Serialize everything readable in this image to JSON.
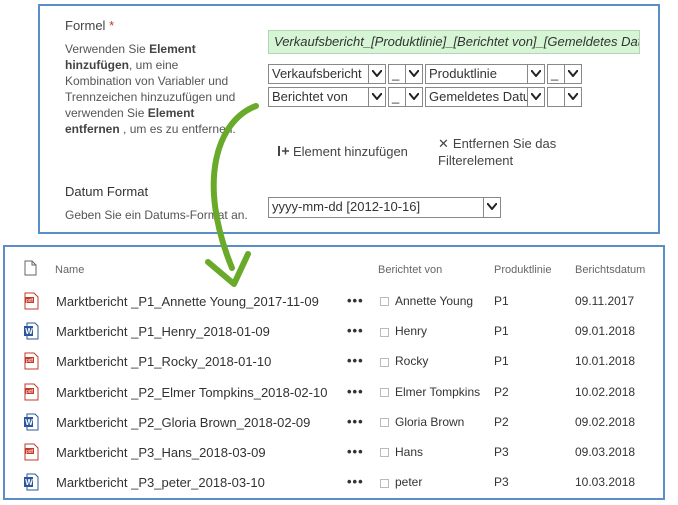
{
  "form": {
    "formel_label": "Formel",
    "required_mark": "*",
    "description_parts": [
      "Verwenden Sie ",
      "Element hinzufügen",
      ", um eine Kombination von Variabler und Trennzeichen hinzuzufügen und verwenden Sie ",
      "Element entfernen",
      " , um es zu entfernen."
    ],
    "formula_value": "Verkaufsbericht_[Produktlinie]_[Berichtet von]_[Gemeldetes Datum]",
    "rows": [
      {
        "var1": "Verkaufsbericht",
        "sep1": "_",
        "var2": "Produktlinie",
        "sep2": "_"
      },
      {
        "var1": "Berichtet von",
        "sep1": "_",
        "var2": "Gemeldetes Datum",
        "sep2": ""
      }
    ],
    "add_element_label": "Element hinzufügen",
    "remove_element_label": "Entfernen Sie das Filterelement",
    "datum_label": "Datum Format",
    "datum_desc": "Geben Sie ein Datums-Format an.",
    "datum_value": "yyyy-mm-dd [2012-10-16]"
  },
  "list": {
    "headers": {
      "name": "Name",
      "reported_by": "Berichtet von",
      "product_line": "Produktlinie",
      "report_date": "Berichtsdatum"
    },
    "more_label": "•••",
    "rows": [
      {
        "icon": "pdf",
        "name": "Marktbericht _P1_Annette Young_2017-11-09",
        "reported_by": "Annette Young",
        "product_line": "P1",
        "date": "09.11.2017"
      },
      {
        "icon": "word",
        "name": "Marktbericht _P1_Henry_2018-01-09",
        "reported_by": "Henry",
        "product_line": "P1",
        "date": "09.01.2018"
      },
      {
        "icon": "pdf",
        "name": "Marktbericht _P1_Rocky_2018-01-10",
        "reported_by": "Rocky",
        "product_line": "P1",
        "date": "10.01.2018"
      },
      {
        "icon": "pdf",
        "name": "Marktbericht _P2_Elmer Tompkins_2018-02-10",
        "reported_by": "Elmer Tompkins",
        "product_line": "P2",
        "date": "10.02.2018"
      },
      {
        "icon": "word",
        "name": "Marktbericht _P2_Gloria Brown_2018-02-09",
        "reported_by": "Gloria Brown",
        "product_line": "P2",
        "date": "09.02.2018"
      },
      {
        "icon": "pdf",
        "name": "Marktbericht _P3_Hans_2018-03-09",
        "reported_by": "Hans",
        "product_line": "P3",
        "date": "09.03.2018"
      },
      {
        "icon": "word",
        "name": "Marktbericht _P3_peter_2018-03-10",
        "reported_by": "peter",
        "product_line": "P3",
        "date": "10.03.2018"
      }
    ]
  },
  "colors": {
    "panel_border": "#5a8ec6",
    "formula_bg": "#d5f5d5",
    "arrow": "#6aaa2a",
    "required": "#c0392b"
  }
}
